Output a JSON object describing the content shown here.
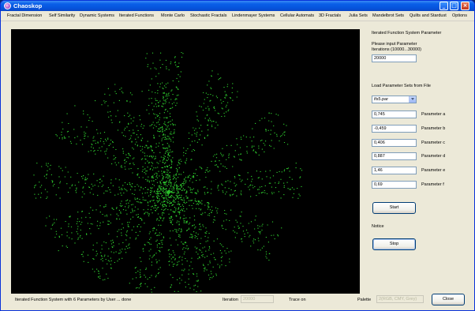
{
  "window": {
    "title": "Chaoskop"
  },
  "menu": [
    "Fractal Dimension",
    "Self Similarity",
    "Dynamic Systems",
    "Iterated Functions",
    "Monte Carlo",
    "Stochastic Fractals",
    "Lindenmayer Systems",
    "Cellular Automats",
    "3D Fractals",
    "Julia Sets",
    "Mandelbrot Sets",
    "Quilts and Stardust",
    "Options"
  ],
  "panel": {
    "heading": "Iterated Function System Parameter",
    "iterations_prompt_line1": "Please input Parameter",
    "iterations_prompt_line2": "Iterations (10000...30000)",
    "iterations_value": "20000",
    "load_label": "Load Parameter Sets from File",
    "file_selected": "ifs5.par",
    "params": [
      {
        "value": "0,745",
        "label": "Parameter a"
      },
      {
        "value": "-0,459",
        "label": "Parameter b"
      },
      {
        "value": "0,406",
        "label": "Parameter c"
      },
      {
        "value": "0,887",
        "label": "Parameter d"
      },
      {
        "value": "1,46",
        "label": "Parameter e"
      },
      {
        "value": "0,69",
        "label": "Parameter f"
      }
    ],
    "start_label": "Start",
    "notice_label": "Notice",
    "stop_label": "Stop"
  },
  "status": {
    "message": "Iterated Function System with 6 Parameters by User ... done",
    "iteration_label": "Iteration",
    "iteration_value": "20000",
    "trace_label": "Trace on",
    "palette_label": "Palette",
    "palette_value": "2(RGB, CMY, Grey)",
    "close_label": "Close"
  },
  "colors": {
    "fractal": "#2ecc2e",
    "canvas": "#000000",
    "titlebar": "#0a5fe8"
  }
}
